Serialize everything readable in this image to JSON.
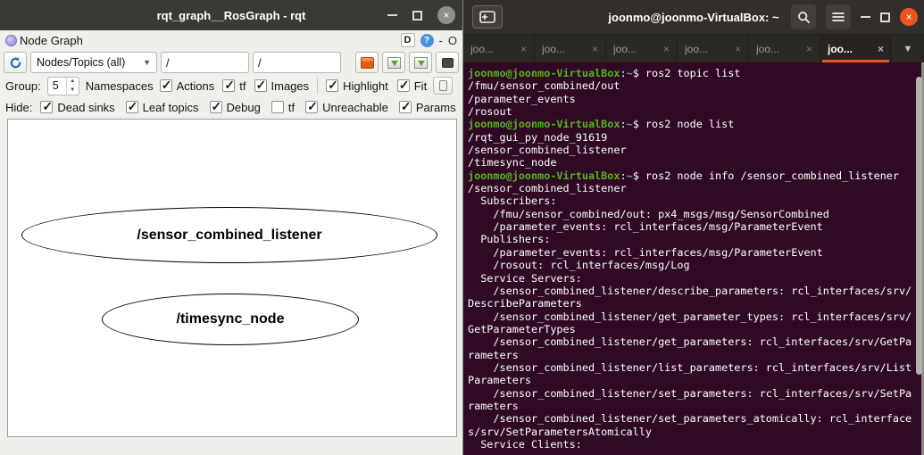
{
  "rqt": {
    "window_title": "rqt_graph__RosGraph - rqt",
    "dock": {
      "title": "Node Graph",
      "detach_button": "D",
      "help_button": "?",
      "minimize_button": "-",
      "close_button": "O"
    },
    "toolbar": {
      "view_mode": "Nodes/Topics (all)",
      "filter1": "/",
      "filter2": "/",
      "group_label": "Group:",
      "group_value": "5",
      "namespaces_label": "Namespaces",
      "row2_checks": [
        {
          "label": "Actions",
          "checked": true
        },
        {
          "label": "tf",
          "checked": true
        },
        {
          "label": "Images",
          "checked": true
        }
      ],
      "row2b_checks": [
        {
          "label": "Highlight",
          "checked": true
        },
        {
          "label": "Fit",
          "checked": true
        }
      ],
      "hide_label": "Hide:",
      "hide_checks": [
        {
          "label": "Dead sinks",
          "checked": true
        },
        {
          "label": "Leaf topics",
          "checked": true
        },
        {
          "label": "Debug",
          "checked": true
        },
        {
          "label": "tf",
          "checked": false
        },
        {
          "label": "Unreachable",
          "checked": true
        },
        {
          "label": "Params",
          "checked": true
        }
      ]
    },
    "graph": {
      "nodes": [
        "/sensor_combined_listener",
        "/timesync_node"
      ]
    }
  },
  "terminal": {
    "window_title": "joonmo@joonmo-VirtualBox: ~",
    "tabs": [
      {
        "label": "joo..."
      },
      {
        "label": "joo..."
      },
      {
        "label": "joo..."
      },
      {
        "label": "joo..."
      },
      {
        "label": "joo..."
      },
      {
        "label": "joo..."
      }
    ],
    "active_tab_index": 5,
    "prompt_user": "joonmo@joonmo-VirtualBox",
    "prompt_path": "~",
    "lines": [
      {
        "prompt": true,
        "command": "ros2 topic list"
      },
      {
        "text": "/fmu/sensor_combined/out"
      },
      {
        "text": "/parameter_events"
      },
      {
        "text": "/rosout"
      },
      {
        "prompt": true,
        "command": "ros2 node list"
      },
      {
        "text": "/rqt_gui_py_node_91619"
      },
      {
        "text": "/sensor_combined_listener"
      },
      {
        "text": "/timesync_node"
      },
      {
        "prompt": true,
        "command": "ros2 node info /sensor_combined_listener"
      },
      {
        "text": "/sensor_combined_listener"
      },
      {
        "text": "  Subscribers:"
      },
      {
        "text": "    /fmu/sensor_combined/out: px4_msgs/msg/SensorCombined"
      },
      {
        "text": "    /parameter_events: rcl_interfaces/msg/ParameterEvent"
      },
      {
        "text": "  Publishers:"
      },
      {
        "text": "    /parameter_events: rcl_interfaces/msg/ParameterEvent"
      },
      {
        "text": "    /rosout: rcl_interfaces/msg/Log"
      },
      {
        "text": "  Service Servers:"
      },
      {
        "text": "    /sensor_combined_listener/describe_parameters: rcl_interfaces/srv/"
      },
      {
        "text": "DescribeParameters"
      },
      {
        "text": "    /sensor_combined_listener/get_parameter_types: rcl_interfaces/srv/"
      },
      {
        "text": "GetParameterTypes"
      },
      {
        "text": "    /sensor_combined_listener/get_parameters: rcl_interfaces/srv/GetPa"
      },
      {
        "text": "rameters"
      },
      {
        "text": "    /sensor_combined_listener/list_parameters: rcl_interfaces/srv/List"
      },
      {
        "text": "Parameters"
      },
      {
        "text": "    /sensor_combined_listener/set_parameters: rcl_interfaces/srv/SetPa"
      },
      {
        "text": "rameters"
      },
      {
        "text": "    /sensor_combined_listener/set_parameters_atomically: rcl_interface"
      },
      {
        "text": "s/srv/SetParametersAtomically"
      },
      {
        "text": "  Service Clients:"
      }
    ]
  },
  "colors": {
    "ubuntu_orange": "#e95420",
    "terminal_background": "#300a24",
    "terminal_text": "#ffffff",
    "prompt_green": "#55b41f",
    "path_blue": "#6f9fce"
  }
}
